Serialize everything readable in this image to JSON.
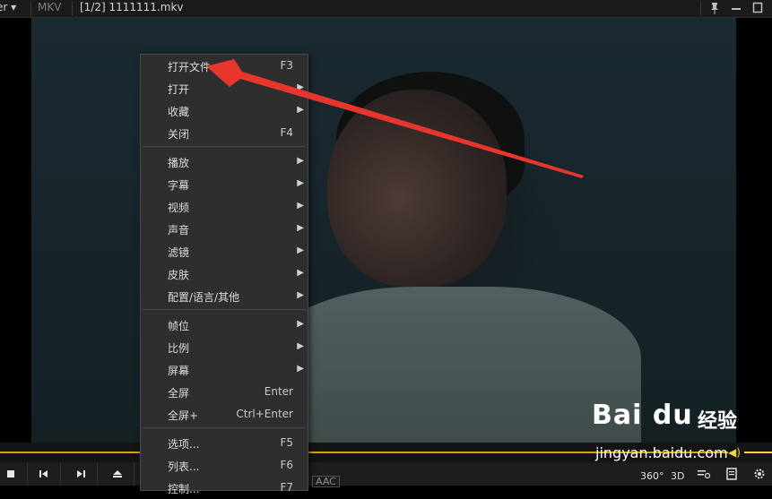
{
  "titlebar": {
    "app": "er",
    "format": "MKV",
    "file": "[1/2] 1111111.mkv"
  },
  "context_menu": {
    "groups": [
      [
        {
          "label": "打开文件",
          "shortcut": "F3",
          "submenu": false
        },
        {
          "label": "打开",
          "shortcut": "",
          "submenu": true
        },
        {
          "label": "收藏",
          "shortcut": "",
          "submenu": true
        },
        {
          "label": "关闭",
          "shortcut": "F4",
          "submenu": false
        }
      ],
      [
        {
          "label": "播放",
          "shortcut": "",
          "submenu": true
        },
        {
          "label": "字幕",
          "shortcut": "",
          "submenu": true
        },
        {
          "label": "视频",
          "shortcut": "",
          "submenu": true
        },
        {
          "label": "声音",
          "shortcut": "",
          "submenu": true
        },
        {
          "label": "滤镜",
          "shortcut": "",
          "submenu": true
        },
        {
          "label": "皮肤",
          "shortcut": "",
          "submenu": true
        },
        {
          "label": "配置/语言/其他",
          "shortcut": "",
          "submenu": true
        }
      ],
      [
        {
          "label": "帧位",
          "shortcut": "",
          "submenu": true
        },
        {
          "label": "比例",
          "shortcut": "",
          "submenu": true
        },
        {
          "label": "屏幕",
          "shortcut": "",
          "submenu": true
        },
        {
          "label": "全屏",
          "shortcut": "Enter",
          "submenu": false
        },
        {
          "label": "全屏+",
          "shortcut": "Ctrl+Enter",
          "submenu": false
        }
      ],
      [
        {
          "label": "选项...",
          "shortcut": "F5",
          "submenu": false
        },
        {
          "label": "列表...",
          "shortcut": "F6",
          "submenu": false
        },
        {
          "label": "控制...",
          "shortcut": "F7",
          "submenu": false
        }
      ]
    ]
  },
  "controls": {
    "audio_codec": "AAC",
    "right_labels": [
      "360°",
      "3D"
    ]
  },
  "watermark": {
    "logo": "Bai du",
    "logo_cn": "经验",
    "url": "jingyan.baidu.com"
  },
  "colors": {
    "accent": "#f2cd1c",
    "arrow": "#e8362f",
    "menu_bg": "#2e2e2e"
  }
}
